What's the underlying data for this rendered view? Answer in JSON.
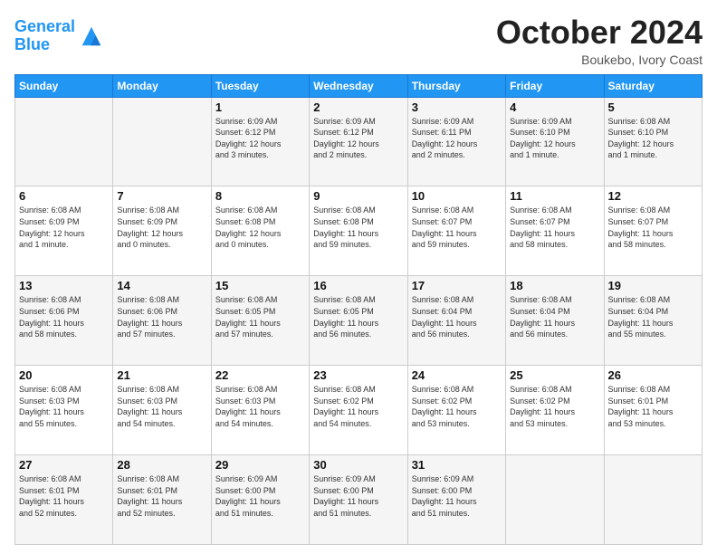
{
  "logo": {
    "line1": "General",
    "line2": "Blue"
  },
  "title": "October 2024",
  "subtitle": "Boukebo, Ivory Coast",
  "weekdays": [
    "Sunday",
    "Monday",
    "Tuesday",
    "Wednesday",
    "Thursday",
    "Friday",
    "Saturday"
  ],
  "weeks": [
    [
      {
        "day": "",
        "info": ""
      },
      {
        "day": "",
        "info": ""
      },
      {
        "day": "1",
        "info": "Sunrise: 6:09 AM\nSunset: 6:12 PM\nDaylight: 12 hours\nand 3 minutes."
      },
      {
        "day": "2",
        "info": "Sunrise: 6:09 AM\nSunset: 6:12 PM\nDaylight: 12 hours\nand 2 minutes."
      },
      {
        "day": "3",
        "info": "Sunrise: 6:09 AM\nSunset: 6:11 PM\nDaylight: 12 hours\nand 2 minutes."
      },
      {
        "day": "4",
        "info": "Sunrise: 6:09 AM\nSunset: 6:10 PM\nDaylight: 12 hours\nand 1 minute."
      },
      {
        "day": "5",
        "info": "Sunrise: 6:08 AM\nSunset: 6:10 PM\nDaylight: 12 hours\nand 1 minute."
      }
    ],
    [
      {
        "day": "6",
        "info": "Sunrise: 6:08 AM\nSunset: 6:09 PM\nDaylight: 12 hours\nand 1 minute."
      },
      {
        "day": "7",
        "info": "Sunrise: 6:08 AM\nSunset: 6:09 PM\nDaylight: 12 hours\nand 0 minutes."
      },
      {
        "day": "8",
        "info": "Sunrise: 6:08 AM\nSunset: 6:08 PM\nDaylight: 12 hours\nand 0 minutes."
      },
      {
        "day": "9",
        "info": "Sunrise: 6:08 AM\nSunset: 6:08 PM\nDaylight: 11 hours\nand 59 minutes."
      },
      {
        "day": "10",
        "info": "Sunrise: 6:08 AM\nSunset: 6:07 PM\nDaylight: 11 hours\nand 59 minutes."
      },
      {
        "day": "11",
        "info": "Sunrise: 6:08 AM\nSunset: 6:07 PM\nDaylight: 11 hours\nand 58 minutes."
      },
      {
        "day": "12",
        "info": "Sunrise: 6:08 AM\nSunset: 6:07 PM\nDaylight: 11 hours\nand 58 minutes."
      }
    ],
    [
      {
        "day": "13",
        "info": "Sunrise: 6:08 AM\nSunset: 6:06 PM\nDaylight: 11 hours\nand 58 minutes."
      },
      {
        "day": "14",
        "info": "Sunrise: 6:08 AM\nSunset: 6:06 PM\nDaylight: 11 hours\nand 57 minutes."
      },
      {
        "day": "15",
        "info": "Sunrise: 6:08 AM\nSunset: 6:05 PM\nDaylight: 11 hours\nand 57 minutes."
      },
      {
        "day": "16",
        "info": "Sunrise: 6:08 AM\nSunset: 6:05 PM\nDaylight: 11 hours\nand 56 minutes."
      },
      {
        "day": "17",
        "info": "Sunrise: 6:08 AM\nSunset: 6:04 PM\nDaylight: 11 hours\nand 56 minutes."
      },
      {
        "day": "18",
        "info": "Sunrise: 6:08 AM\nSunset: 6:04 PM\nDaylight: 11 hours\nand 56 minutes."
      },
      {
        "day": "19",
        "info": "Sunrise: 6:08 AM\nSunset: 6:04 PM\nDaylight: 11 hours\nand 55 minutes."
      }
    ],
    [
      {
        "day": "20",
        "info": "Sunrise: 6:08 AM\nSunset: 6:03 PM\nDaylight: 11 hours\nand 55 minutes."
      },
      {
        "day": "21",
        "info": "Sunrise: 6:08 AM\nSunset: 6:03 PM\nDaylight: 11 hours\nand 54 minutes."
      },
      {
        "day": "22",
        "info": "Sunrise: 6:08 AM\nSunset: 6:03 PM\nDaylight: 11 hours\nand 54 minutes."
      },
      {
        "day": "23",
        "info": "Sunrise: 6:08 AM\nSunset: 6:02 PM\nDaylight: 11 hours\nand 54 minutes."
      },
      {
        "day": "24",
        "info": "Sunrise: 6:08 AM\nSunset: 6:02 PM\nDaylight: 11 hours\nand 53 minutes."
      },
      {
        "day": "25",
        "info": "Sunrise: 6:08 AM\nSunset: 6:02 PM\nDaylight: 11 hours\nand 53 minutes."
      },
      {
        "day": "26",
        "info": "Sunrise: 6:08 AM\nSunset: 6:01 PM\nDaylight: 11 hours\nand 53 minutes."
      }
    ],
    [
      {
        "day": "27",
        "info": "Sunrise: 6:08 AM\nSunset: 6:01 PM\nDaylight: 11 hours\nand 52 minutes."
      },
      {
        "day": "28",
        "info": "Sunrise: 6:08 AM\nSunset: 6:01 PM\nDaylight: 11 hours\nand 52 minutes."
      },
      {
        "day": "29",
        "info": "Sunrise: 6:09 AM\nSunset: 6:00 PM\nDaylight: 11 hours\nand 51 minutes."
      },
      {
        "day": "30",
        "info": "Sunrise: 6:09 AM\nSunset: 6:00 PM\nDaylight: 11 hours\nand 51 minutes."
      },
      {
        "day": "31",
        "info": "Sunrise: 6:09 AM\nSunset: 6:00 PM\nDaylight: 11 hours\nand 51 minutes."
      },
      {
        "day": "",
        "info": ""
      },
      {
        "day": "",
        "info": ""
      }
    ]
  ]
}
